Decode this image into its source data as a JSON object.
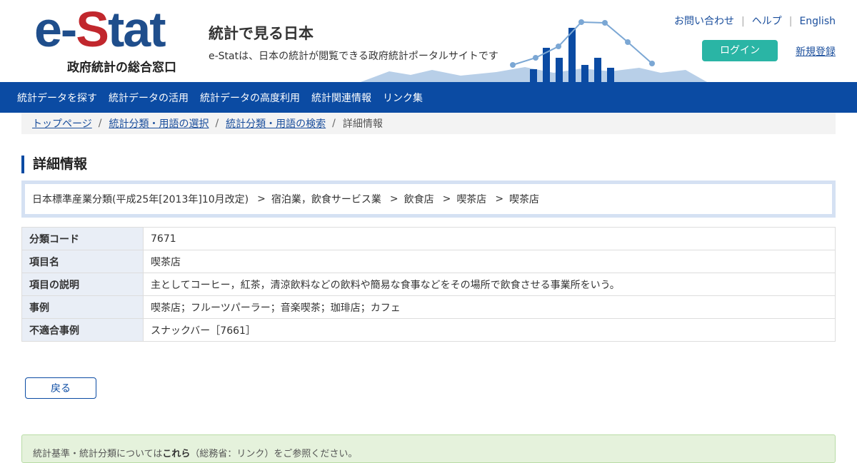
{
  "logo": {
    "mark_left": "e-",
    "mark_s": "S",
    "mark_right": "tat",
    "subtitle": "政府統計の総合窓口"
  },
  "site": {
    "title": "統計で見る日本",
    "description": "e-Statは、日本の統計が閲覧できる政府統計ポータルサイトです"
  },
  "top_links": {
    "contact": "お問い合わせ",
    "help": "ヘルプ",
    "english": "English",
    "separator": "|"
  },
  "account": {
    "login": "ログイン",
    "signup": "新規登録"
  },
  "nav": {
    "items": [
      "統計データを探す",
      "統計データの活用",
      "統計データの高度利用",
      "統計関連情報",
      "リンク集"
    ]
  },
  "breadcrumb": {
    "items": [
      "トップページ",
      "統計分類・用語の選択",
      "統計分類・用語の検索"
    ],
    "current": "詳細情報",
    "separator": "/"
  },
  "heading": "詳細情報",
  "classification_path": {
    "items": [
      "日本標準産業分類(平成25年[2013年]10月改定)",
      "宿泊業，飲食サービス業",
      "飲食店",
      "喫茶店",
      "喫茶店"
    ],
    "arrow": ">"
  },
  "details": [
    {
      "key": "分類コード",
      "value": "7671"
    },
    {
      "key": "項目名",
      "value": "喫茶店"
    },
    {
      "key": "項目の説明",
      "value": "主としてコーヒー，紅茶，清涼飲料などの飲料や簡易な食事などをその場所で飲食させる事業所をいう。"
    },
    {
      "key": "事例",
      "value": "喫茶店；フルーツパーラー；音楽喫茶；珈琲店；カフェ"
    },
    {
      "key": "不適合事例",
      "value": "スナックバー［7661］"
    }
  ],
  "back_button": "戻る",
  "notice": {
    "before": "統計基準・統計分類については",
    "link": "これら",
    "after": "（総務省：リンク）をご参照ください。"
  },
  "colors": {
    "brand_blue": "#0b4ba3",
    "logo_red": "#c1272d",
    "login_teal": "#2ab5a5"
  }
}
